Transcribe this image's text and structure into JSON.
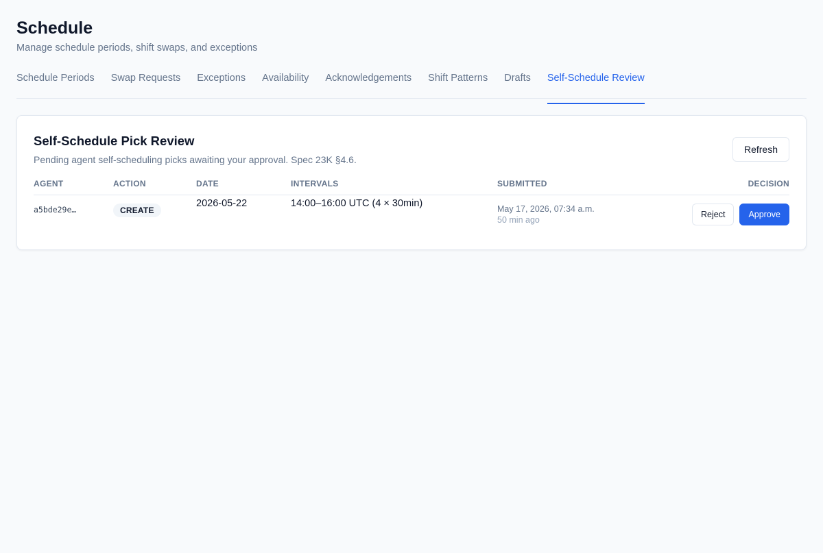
{
  "header": {
    "title": "Schedule",
    "subtitle": "Manage schedule periods, shift swaps, and exceptions"
  },
  "tabs": [
    {
      "label": "Schedule Periods",
      "active": false
    },
    {
      "label": "Swap Requests",
      "active": false
    },
    {
      "label": "Exceptions",
      "active": false
    },
    {
      "label": "Availability",
      "active": false
    },
    {
      "label": "Acknowledgements",
      "active": false
    },
    {
      "label": "Shift Patterns",
      "active": false
    },
    {
      "label": "Drafts",
      "active": false
    },
    {
      "label": "Self-Schedule Review",
      "active": true
    }
  ],
  "card": {
    "title": "Self-Schedule Pick Review",
    "description": "Pending agent self-scheduling picks awaiting your approval. Spec 23K §4.6.",
    "refresh_label": "Refresh"
  },
  "table": {
    "columns": [
      "Agent",
      "Action",
      "Date",
      "Intervals",
      "Submitted",
      "Decision"
    ],
    "rows": [
      {
        "agent": "a5bde29e…",
        "action": "CREATE",
        "date": "2026-05-22",
        "intervals": "14:00–16:00 UTC (4 × 30min)",
        "submitted": "May 17, 2026, 07:34 a.m.",
        "submitted_ago": "50 min ago",
        "reject_label": "Reject",
        "approve_label": "Approve"
      }
    ]
  },
  "colors": {
    "accent": "#2563eb",
    "background": "#f8fafc",
    "muted_text": "#64748b"
  }
}
